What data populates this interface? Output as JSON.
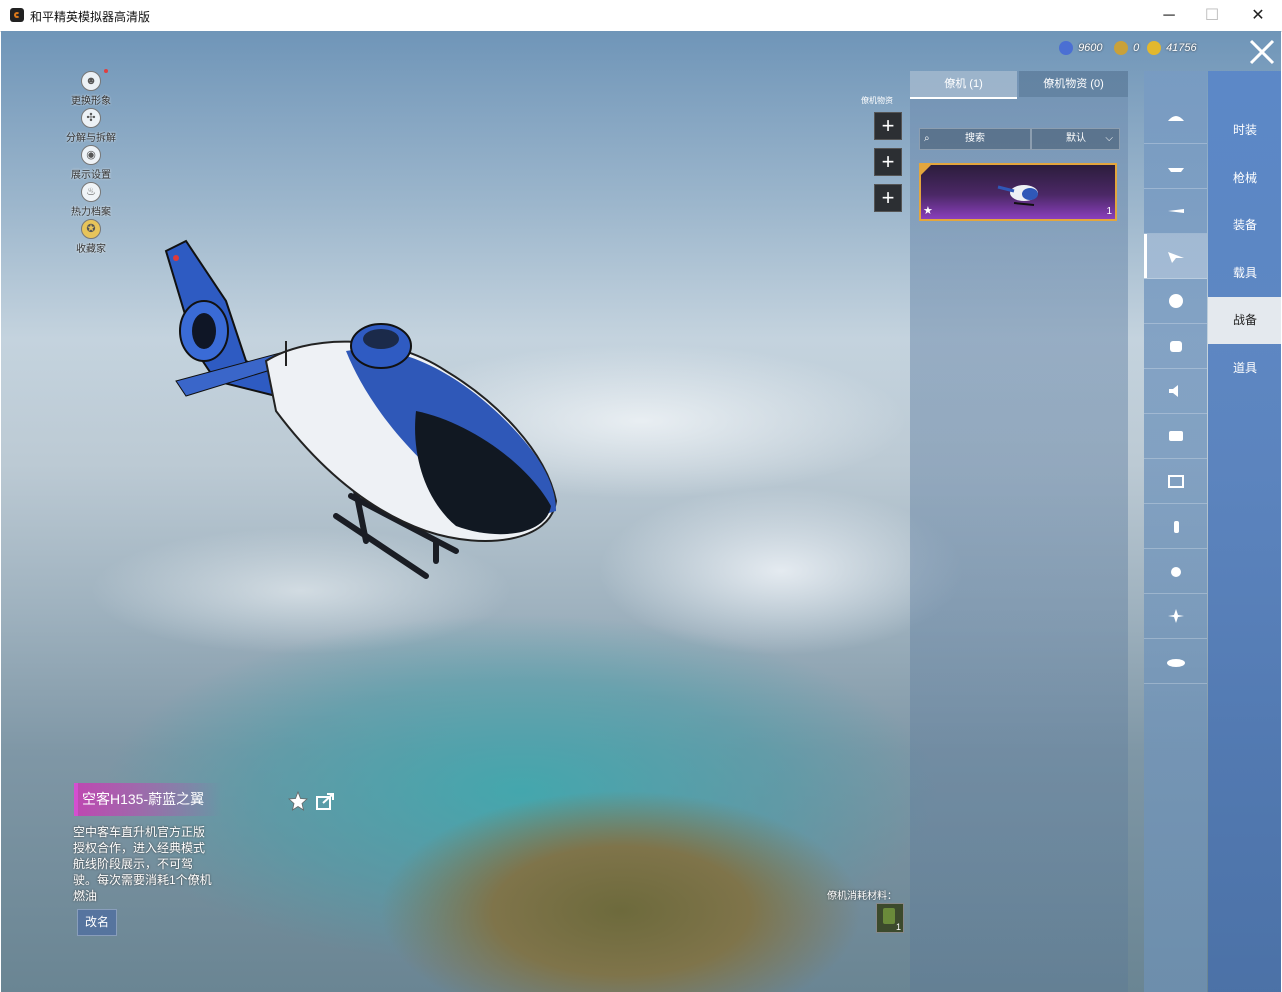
{
  "window": {
    "title": "和平精英模拟器高清版"
  },
  "side_menu": [
    {
      "label": "更换形象",
      "icon": "avatar-icon"
    },
    {
      "label": "分解与拆解",
      "icon": "decompose-icon"
    },
    {
      "label": "展示设置",
      "icon": "eye-icon"
    },
    {
      "label": "热力档案",
      "icon": "flame-icon"
    },
    {
      "label": "收藏家",
      "icon": "collector-badge-icon"
    }
  ],
  "currency": [
    {
      "icon": "coupon-icon",
      "value": "9600",
      "color": "#4b6fd3"
    },
    {
      "icon": "medal-icon",
      "value": "0",
      "color": "#c9a13a"
    },
    {
      "icon": "gold-coin-icon",
      "value": "41756",
      "color": "#e3b82e"
    }
  ],
  "tabs": [
    {
      "label": "僚机 (1)"
    },
    {
      "label": "僚机物资 (0)"
    }
  ],
  "search": {
    "placeholder": "搜索"
  },
  "sort": {
    "label": "默认"
  },
  "filter_label": "僚机物资",
  "categories": [
    {
      "label": "时装"
    },
    {
      "label": "枪械"
    },
    {
      "label": "装备"
    },
    {
      "label": "载具"
    },
    {
      "label": "战备"
    },
    {
      "label": "道具"
    }
  ],
  "icon_column": [
    "parachute-icon",
    "boat-icon",
    "plane-icon",
    "wingman-icon",
    "emote-icon",
    "robot-icon",
    "sound-icon",
    "chat-icon",
    "gallery-icon",
    "extinguisher-icon",
    "hand-icon",
    "sparkle-icon",
    "hat-icon"
  ],
  "item": {
    "name": "空客H135-蔚蓝之翼",
    "description": "空中客车直升机官方正版授权合作，进入经典模式航线阶段展示，不可驾驶。每次需要消耗1个僚机燃油",
    "rename_label": "改名",
    "count": "1"
  },
  "consume_label": "僚机消耗材料：",
  "material_count": "1",
  "colors": {
    "card_border": "#e3a63d",
    "card_bg": "#4b2866",
    "accent_pink": "#d44fd0",
    "category_bar": "#5a87c8"
  }
}
